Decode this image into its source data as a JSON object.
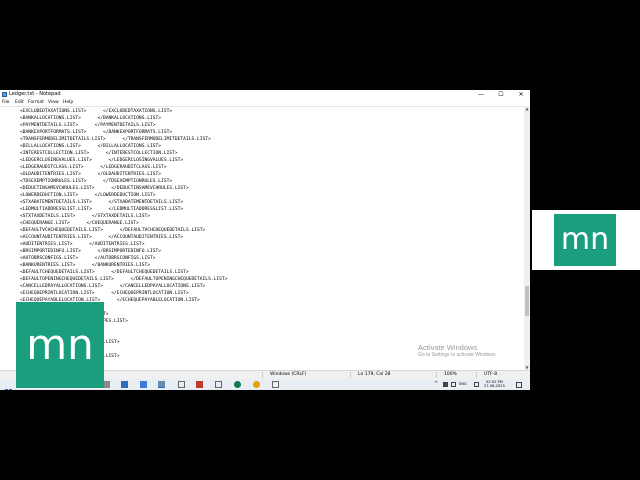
{
  "window": {
    "title": "Ledger.txt - Notepad",
    "controls": {
      "minimize": "—",
      "maximize": "☐",
      "close": "✕"
    }
  },
  "menu": {
    "items": [
      "File",
      "Edit",
      "Format",
      "View",
      "Help"
    ]
  },
  "editor": {
    "lines": [
      "<EXCLUDEDTAXATIONS.LIST>      </EXCLUDEDTAXATIONS.LIST>",
      "<BANKALLOCATIONS.LIST>      </BANKALLOCATIONS.LIST>",
      "<PAYMENTDETAILS.LIST>      </PAYMENTDETAILS.LIST>",
      "<BANKEXPORTFORMATS.LIST>      </BANKEXPORTFORMATS.LIST>",
      "<TRANSFERMODELIMITDETAILS.LIST>      </TRANSFERMODELIMITDETAILS.LIST>",
      "<BILLALLOCATIONS.LIST>      </BILLALLOCATIONS.LIST>",
      "<INTERESTCOLLECTION.LIST>      </INTERESTCOLLECTION.LIST>",
      "<LEDGERCLOSINGVALUES.LIST>      </LEDGERCLOSINGVALUES.LIST>",
      "<LEDGERAUDITCLASS.LIST>      </LEDGERAUDITCLASS.LIST>",
      "<OLDAUDITENTRIES.LIST>      </OLDAUDITENTRIES.LIST>",
      "<TDSEXEMPTIONRULES.LIST>      </TDSEXEMPTIONRULES.LIST>",
      "<DEDUCTINSAMEVCHRULES.LIST>      </DEDUCTINSAMEVCHRULES.LIST>",
      "<LOWERDEDUCTION.LIST>      </LOWERDEDUCTION.LIST>",
      "<STXABATEMENTDETAILS.LIST>      </STXABATEMENTDETAILS.LIST>",
      "<LEDMULTIADDRESSLIST.LIST>      </LEDMULTIADDRESSLIST.LIST>",
      "<STXTAXDETAILS.LIST>      </STXTAXDETAILS.LIST>",
      "<CHEQUERANGE.LIST>      </CHEQUERANGE.LIST>",
      "<DEFAULTVCHCHEQUEDETAILS.LIST>      </DEFAULTVCHCHEQUEDETAILS.LIST>",
      "<ACCOUNTAUDITENTRIES.LIST>      </ACCOUNTAUDITENTRIES.LIST>",
      "<AUDITENTRIES.LIST>      </AUDITENTRIES.LIST>",
      "<BRSIMPORTEDINFO.LIST>      </BRSIMPORTEDINFO.LIST>",
      "<AUTOBRSCONFIGS.LIST>      </AUTOBRSCONFIGS.LIST>",
      "<BANKURENTRIES.LIST>      </BANKURENTRIES.LIST>",
      "<DEFAULTCHEQUEDETAILS.LIST>      </DEFAULTCHEQUEDETAILS.LIST>",
      "<DEFAULTOPENINGCHEQUEDETAILS.LIST>      </DEFAULTOPENINGCHEQUEDETAILS.LIST>",
      "<CANCELLEDPAYALLOCATIONS.LIST>      </CANCELLEDPAYALLOCATIONS.LIST>",
      "<ECHEQUEPRINTLOCATION.LIST>      </ECHEQUEPRINTLOCATION.LIST>",
      "<ECHEQUEPAYABLELOCATION.LIST>      </ECHEQUEPAYABLELOCATION.LIST>",
      "      </EDDPRINTLOCATION.LIST>",
      "      </EDDPAYABLELOCATION.LIST>",
      "      </AVAILABLETRANSACTIONTYPES.LIST>",
      "      </LEDPAYINSCONFIGS.LIST>",
      "      </TYPECODEDETAILS.LIST>",
      "      </FIELDVALIDATIONDETAILS.LIST>",
      "      </INPUTCRALLOCS.LIST>",
      "      </TCSMETHODOFCALCULATION.LIST>"
    ]
  },
  "status": {
    "encoding": "Windows (CRLF)",
    "position": "Ln 179, Col 28",
    "zoom": "100%",
    "charset": "UTF-8"
  },
  "watermark": {
    "title": "Activate Windows",
    "subtitle": "Go to Settings to activate Windows."
  },
  "taskbar": {
    "language": "ENG",
    "time": "02:52 PM",
    "date": "27-06-2025",
    "tray_arrow": "^"
  },
  "logos": {
    "text": "mn",
    "color": "#1a9e7e"
  }
}
